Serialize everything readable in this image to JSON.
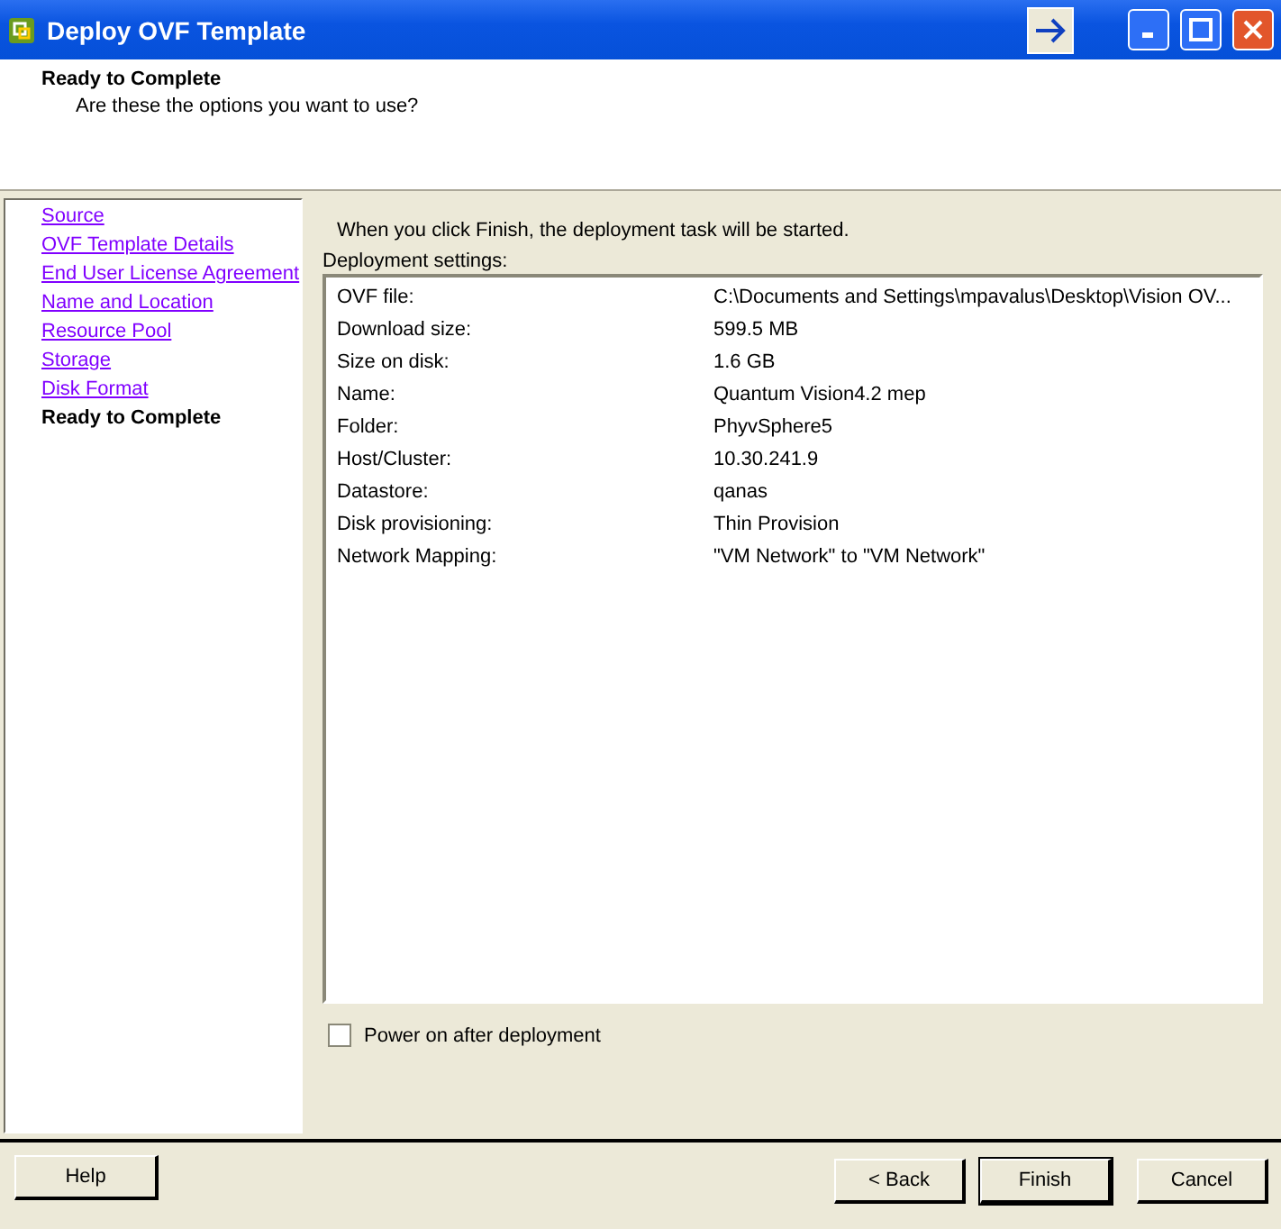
{
  "window": {
    "title": "Deploy OVF Template"
  },
  "header": {
    "title": "Ready to Complete",
    "subtitle": "Are these the options you want to use?"
  },
  "steps": [
    {
      "label": "Source",
      "selected": false
    },
    {
      "label": "OVF Template Details",
      "selected": false
    },
    {
      "label": "End User License Agreement",
      "selected": false
    },
    {
      "label": "Name and Location",
      "selected": false
    },
    {
      "label": "Resource Pool",
      "selected": false
    },
    {
      "label": "Storage",
      "selected": false
    },
    {
      "label": "Disk Format",
      "selected": false
    },
    {
      "label": "Ready to Complete",
      "selected": true
    }
  ],
  "intro": "When you click Finish, the deployment task will be started.",
  "settings_label": "Deployment settings:",
  "settings": [
    {
      "name": "OVF file:",
      "value": "C:\\Documents and Settings\\mpavalus\\Desktop\\Vision OV..."
    },
    {
      "name": "Download size:",
      "value": "599.5 MB"
    },
    {
      "name": "Size on disk:",
      "value": "1.6 GB"
    },
    {
      "name": "Name:",
      "value": "Quantum Vision4.2 mep"
    },
    {
      "name": "Folder:",
      "value": "PhyvSphere5"
    },
    {
      "name": "Host/Cluster:",
      "value": "10.30.241.9"
    },
    {
      "name": "Datastore:",
      "value": "qanas"
    },
    {
      "name": "Disk provisioning:",
      "value": "Thin Provision"
    },
    {
      "name": "Network Mapping:",
      "value": "\"VM Network\" to \"VM Network\""
    }
  ],
  "power_on": {
    "label": "Power on after deployment",
    "checked": false
  },
  "buttons": {
    "help": "Help",
    "back": "< Back",
    "finish": "Finish",
    "cancel": "Cancel"
  }
}
